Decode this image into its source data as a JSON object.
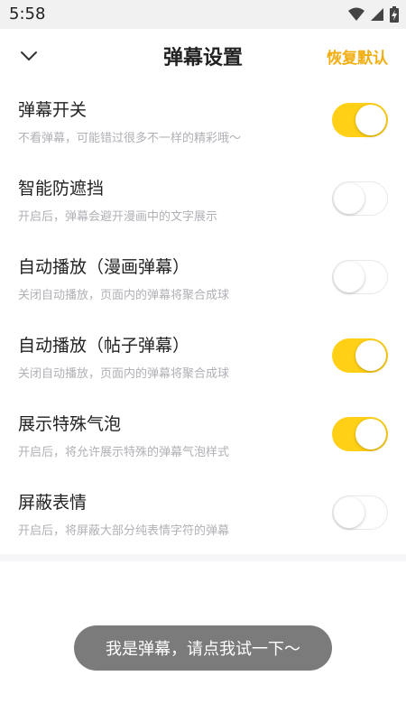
{
  "status_bar": {
    "time": "5:58",
    "icons": [
      "wifi-icon",
      "signal-icon",
      "battery-charging-icon"
    ]
  },
  "header": {
    "back_icon": "chevron-down-icon",
    "title": "弹幕设置",
    "reset_label": "恢复默认"
  },
  "colors": {
    "accent": "#ffd016",
    "reset_text": "#f2ad0f",
    "toast_bg": "#7b7b7b"
  },
  "settings": [
    {
      "title": "弹幕开关",
      "desc": "不看弹幕，可能错过很多不一样的精彩哦～",
      "enabled": true
    },
    {
      "title": "智能防遮挡",
      "desc": "开启后，弹幕会避开漫画中的文字展示",
      "enabled": false
    },
    {
      "title": "自动播放（漫画弹幕）",
      "desc": "关闭自动播放，页面内的弹幕将聚合成球",
      "enabled": false
    },
    {
      "title": "自动播放（帖子弹幕）",
      "desc": "关闭自动播放，页面内的弹幕将聚合成球",
      "enabled": true
    },
    {
      "title": "展示特殊气泡",
      "desc": "开启后，将允许展示特殊的弹幕气泡样式",
      "enabled": true
    },
    {
      "title": "屏蔽表情",
      "desc": "开启后，将屏蔽大部分纯表情字符的弹幕",
      "enabled": false
    }
  ],
  "toast": {
    "text": "我是弹幕，请点我试一下～"
  }
}
